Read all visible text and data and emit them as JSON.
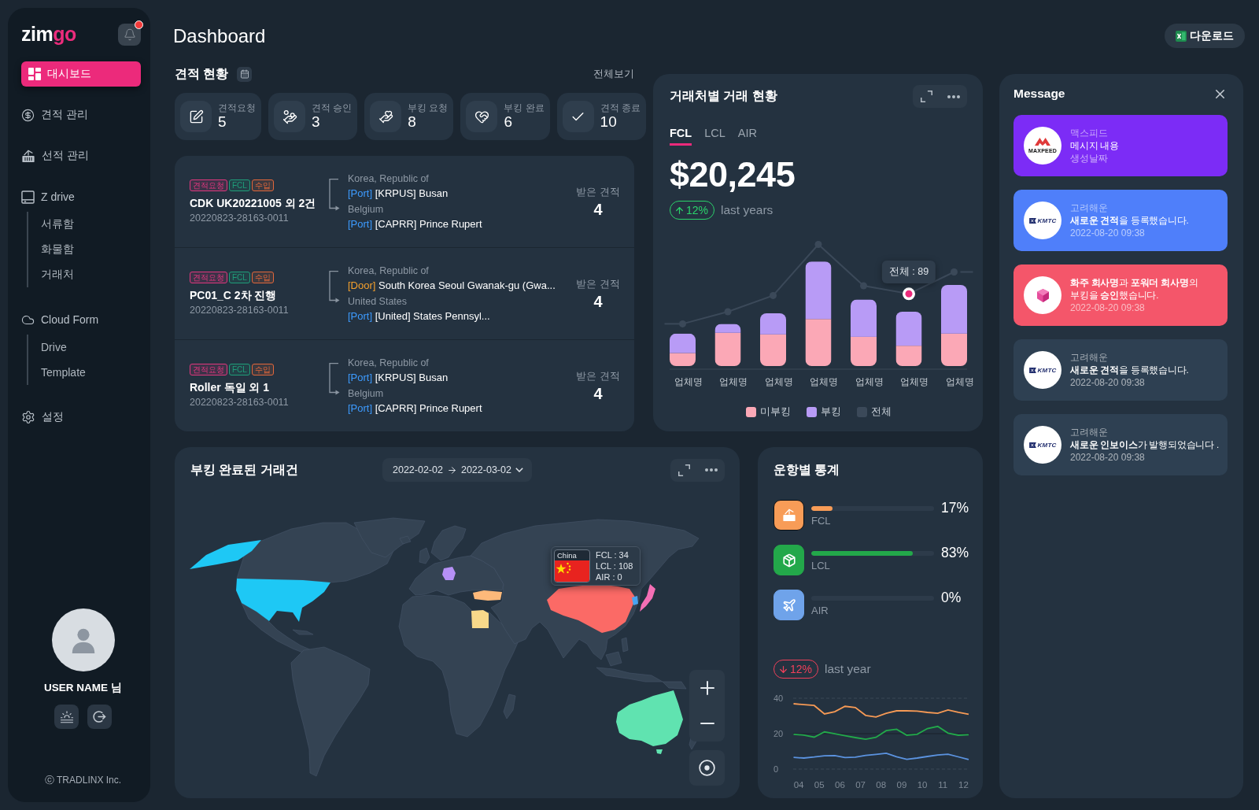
{
  "sidebar": {
    "logo": {
      "parts": [
        "zim",
        "go"
      ]
    },
    "notifications": {
      "unread": true
    },
    "nav": [
      {
        "label": "대시보드",
        "selected": true
      },
      {
        "label": "견적 관리",
        "selected": false
      },
      {
        "label": "선적 관리",
        "selected": false
      },
      {
        "label": "Z drive",
        "selected": false,
        "children": [
          {
            "label": "서류함"
          },
          {
            "label": "화물함"
          },
          {
            "label": "거래처"
          }
        ]
      },
      {
        "label": "Cloud Form",
        "selected": false,
        "children": [
          {
            "label": "Drive"
          },
          {
            "label": "Template"
          }
        ]
      },
      {
        "label": "설정",
        "selected": false
      }
    ],
    "user": {
      "name": "USER NAME 님"
    },
    "copyright": "ⓒ TRADLINX Inc."
  },
  "header": {
    "title": "Dashboard",
    "download_button": "다운로드"
  },
  "quotes": {
    "title": "견적 현황",
    "view_all": "전체보기",
    "stats": [
      {
        "label": "견적요청",
        "value": "5"
      },
      {
        "label": "견적 승인",
        "value": "3"
      },
      {
        "label": "부킹 요청",
        "value": "8"
      },
      {
        "label": "부킹 완료",
        "value": "6"
      },
      {
        "label": "견적 종료",
        "value": "10"
      }
    ],
    "items": [
      {
        "tags": [
          {
            "label": "견적요청",
            "color": "#e0377e"
          },
          {
            "label": "FCL",
            "color": "#1f9e7a"
          },
          {
            "label": "수입",
            "color": "#e2673b"
          }
        ],
        "title": "CDK UK20221005 외 2건",
        "number": "20220823-28163-0011",
        "origin": {
          "country": "Korea, Republic of",
          "kind": "port",
          "tag": "[Port]",
          "place": "[KRPUS] Busan"
        },
        "destination": {
          "country": "Belgium",
          "kind": "port",
          "tag": "[Port]",
          "place": "[CAPRR] Prince Rupert"
        },
        "received_label": "받은 견적",
        "received_count": "4"
      },
      {
        "tags": [
          {
            "label": "견적요청",
            "color": "#e0377e"
          },
          {
            "label": "FCL",
            "color": "#1f9e7a"
          },
          {
            "label": "수입",
            "color": "#e2673b"
          }
        ],
        "title": "PC01_C 2차 진행",
        "number": "20220823-28163-0011",
        "origin": {
          "country": "Korea, Republic of",
          "kind": "door",
          "tag": "[Door]",
          "place": "South Korea Seoul Gwanak-gu (Gwa..."
        },
        "destination": {
          "country": "United States",
          "kind": "port",
          "tag": "[Port]",
          "place": "[United] States Pennsyl..."
        },
        "received_label": "받은 견적",
        "received_count": "4"
      },
      {
        "tags": [
          {
            "label": "견적요청",
            "color": "#e0377e"
          },
          {
            "label": "FCL",
            "color": "#1f9e7a"
          },
          {
            "label": "수입",
            "color": "#e2673b"
          }
        ],
        "title": "Roller 독일 외 1",
        "number": "20220823-28163-0011",
        "origin": {
          "country": "Korea, Republic of",
          "kind": "port",
          "tag": "[Port]",
          "place": "[KRPUS] Busan"
        },
        "destination": {
          "country": "Belgium",
          "kind": "port",
          "tag": "[Port]",
          "place": "[CAPRR] Prince Rupert"
        },
        "received_label": "받은 견적",
        "received_count": "4"
      }
    ]
  },
  "trade_chart": {
    "title": "거래처별 거래 현황",
    "tabs": [
      {
        "label": "FCL",
        "selected": true
      },
      {
        "label": "LCL",
        "selected": false
      },
      {
        "label": "AIR",
        "selected": false
      }
    ],
    "amount": "$20,245",
    "change": {
      "kind": "up",
      "text": "12%"
    },
    "change_label": "last years",
    "chart": {
      "x_labels": [
        "업체명",
        "업체명",
        "업체명",
        "업체명",
        "업체명",
        "업체명",
        "업체명"
      ],
      "tooltip": "전체 : 89",
      "legend": [
        {
          "label": "미부킹",
          "color": "#fba8b6"
        },
        {
          "label": "부킹",
          "color": "#b89bf6"
        },
        {
          "label": "전체",
          "color": "#3b4959"
        }
      ]
    }
  },
  "booking_map": {
    "title": "부킹 완료된 거래건",
    "date_range": {
      "start": "2022-02-02",
      "end": "2022-03-02"
    },
    "tooltip": {
      "country": "China",
      "lines": [
        "FCL : 34",
        "LCL : 108",
        "AIR : 0"
      ]
    }
  },
  "route_stats": {
    "title": "운항별 통계",
    "modes": [
      {
        "label": "FCL",
        "percent": "17%",
        "level": 0.17,
        "color": "#f89c57",
        "selected": true
      },
      {
        "label": "LCL",
        "percent": "83%",
        "level": 0.83,
        "color": "#23a84a",
        "selected": false
      },
      {
        "label": "AIR",
        "percent": "0%",
        "color": "#6fa3ea",
        "selected": false
      }
    ],
    "change": {
      "kind": "down",
      "text": "12%"
    },
    "change_label": "last year",
    "chart_data": {
      "type": "line",
      "x": [
        3.75,
        4.25,
        4.75,
        5.25,
        5.75,
        6.25,
        6.75,
        7.25,
        7.75,
        8.25,
        8.75,
        9.25,
        9.75,
        10.25,
        10.75,
        11.25,
        11.75,
        12.25
      ],
      "xlim": [
        3.73,
        12.29
      ],
      "ylim": [
        0,
        40
      ],
      "xticks": [
        {
          "value": 4,
          "label": "04"
        },
        {
          "value": 5,
          "label": "05"
        },
        {
          "value": 6,
          "label": "06"
        },
        {
          "value": 7,
          "label": "07"
        },
        {
          "value": 8,
          "label": "08"
        },
        {
          "value": 9,
          "label": "09"
        },
        {
          "value": 10,
          "label": "10"
        },
        {
          "value": 11,
          "label": "11"
        },
        {
          "value": 12,
          "label": "12"
        }
      ],
      "yticks": [
        0,
        20,
        40
      ],
      "series": [
        {
          "color": "#f79a55",
          "values": [
            36.9,
            36.4,
            35.9,
            31.1,
            32.4,
            35.4,
            34.7,
            30.3,
            29.4,
            31.5,
            32.9,
            32.9,
            32.7,
            32.0,
            31.5,
            33.4,
            32.1,
            31.0
          ]
        },
        {
          "color": "#22a94a",
          "values": [
            19.6,
            19.2,
            18.0,
            21.0,
            19.9,
            18.8,
            17.8,
            16.8,
            17.9,
            21.7,
            22.5,
            19.1,
            19.6,
            22.9,
            24.1,
            20.3,
            19.1,
            19.4
          ]
        },
        {
          "color": "#5b93e0",
          "values": [
            6.6,
            6.2,
            6.8,
            7.5,
            7.6,
            6.5,
            6.7,
            7.7,
            8.3,
            9.0,
            7.0,
            5.5,
            6.2,
            7.1,
            7.9,
            8.4,
            6.9,
            5.4
          ]
        }
      ]
    }
  },
  "messages": {
    "title": "Message",
    "items": [
      {
        "color": "#7c2cf6",
        "logo": {
          "kind": "peak",
          "text": "MAXPEED"
        },
        "sender": "맥스피드",
        "text": "메시지 내용",
        "time": "생성날짜"
      },
      {
        "color": "#4f7ffa",
        "logo": {
          "kind": "flag",
          "text": "KMTC"
        },
        "sender": "고려해운",
        "text": "**새로운 견적**을 등록했습니다.",
        "time": "2022-08-20 09:38"
      },
      {
        "color": "#f4566a",
        "logo": {
          "kind": "cube"
        },
        "text": "**화주 회사명**과 **포워더 회사명**의 부킹을 **승인**했습니다.",
        "time": "2022-08-20 09:38"
      },
      {
        "color": "#2e4052",
        "logo": {
          "kind": "flag",
          "text": "KMTC"
        },
        "sender": "고려해운",
        "text": "**새로운 견적**을 등록했습니다.",
        "time": "2022-08-20 09:38"
      },
      {
        "color": "#2e4052",
        "logo": {
          "kind": "flag",
          "text": "KMTC"
        },
        "sender": "고려해운",
        "text": "**새로운 인보이스**가 발행되었습니다 .",
        "time": "2022-08-20 09:38"
      }
    ]
  }
}
